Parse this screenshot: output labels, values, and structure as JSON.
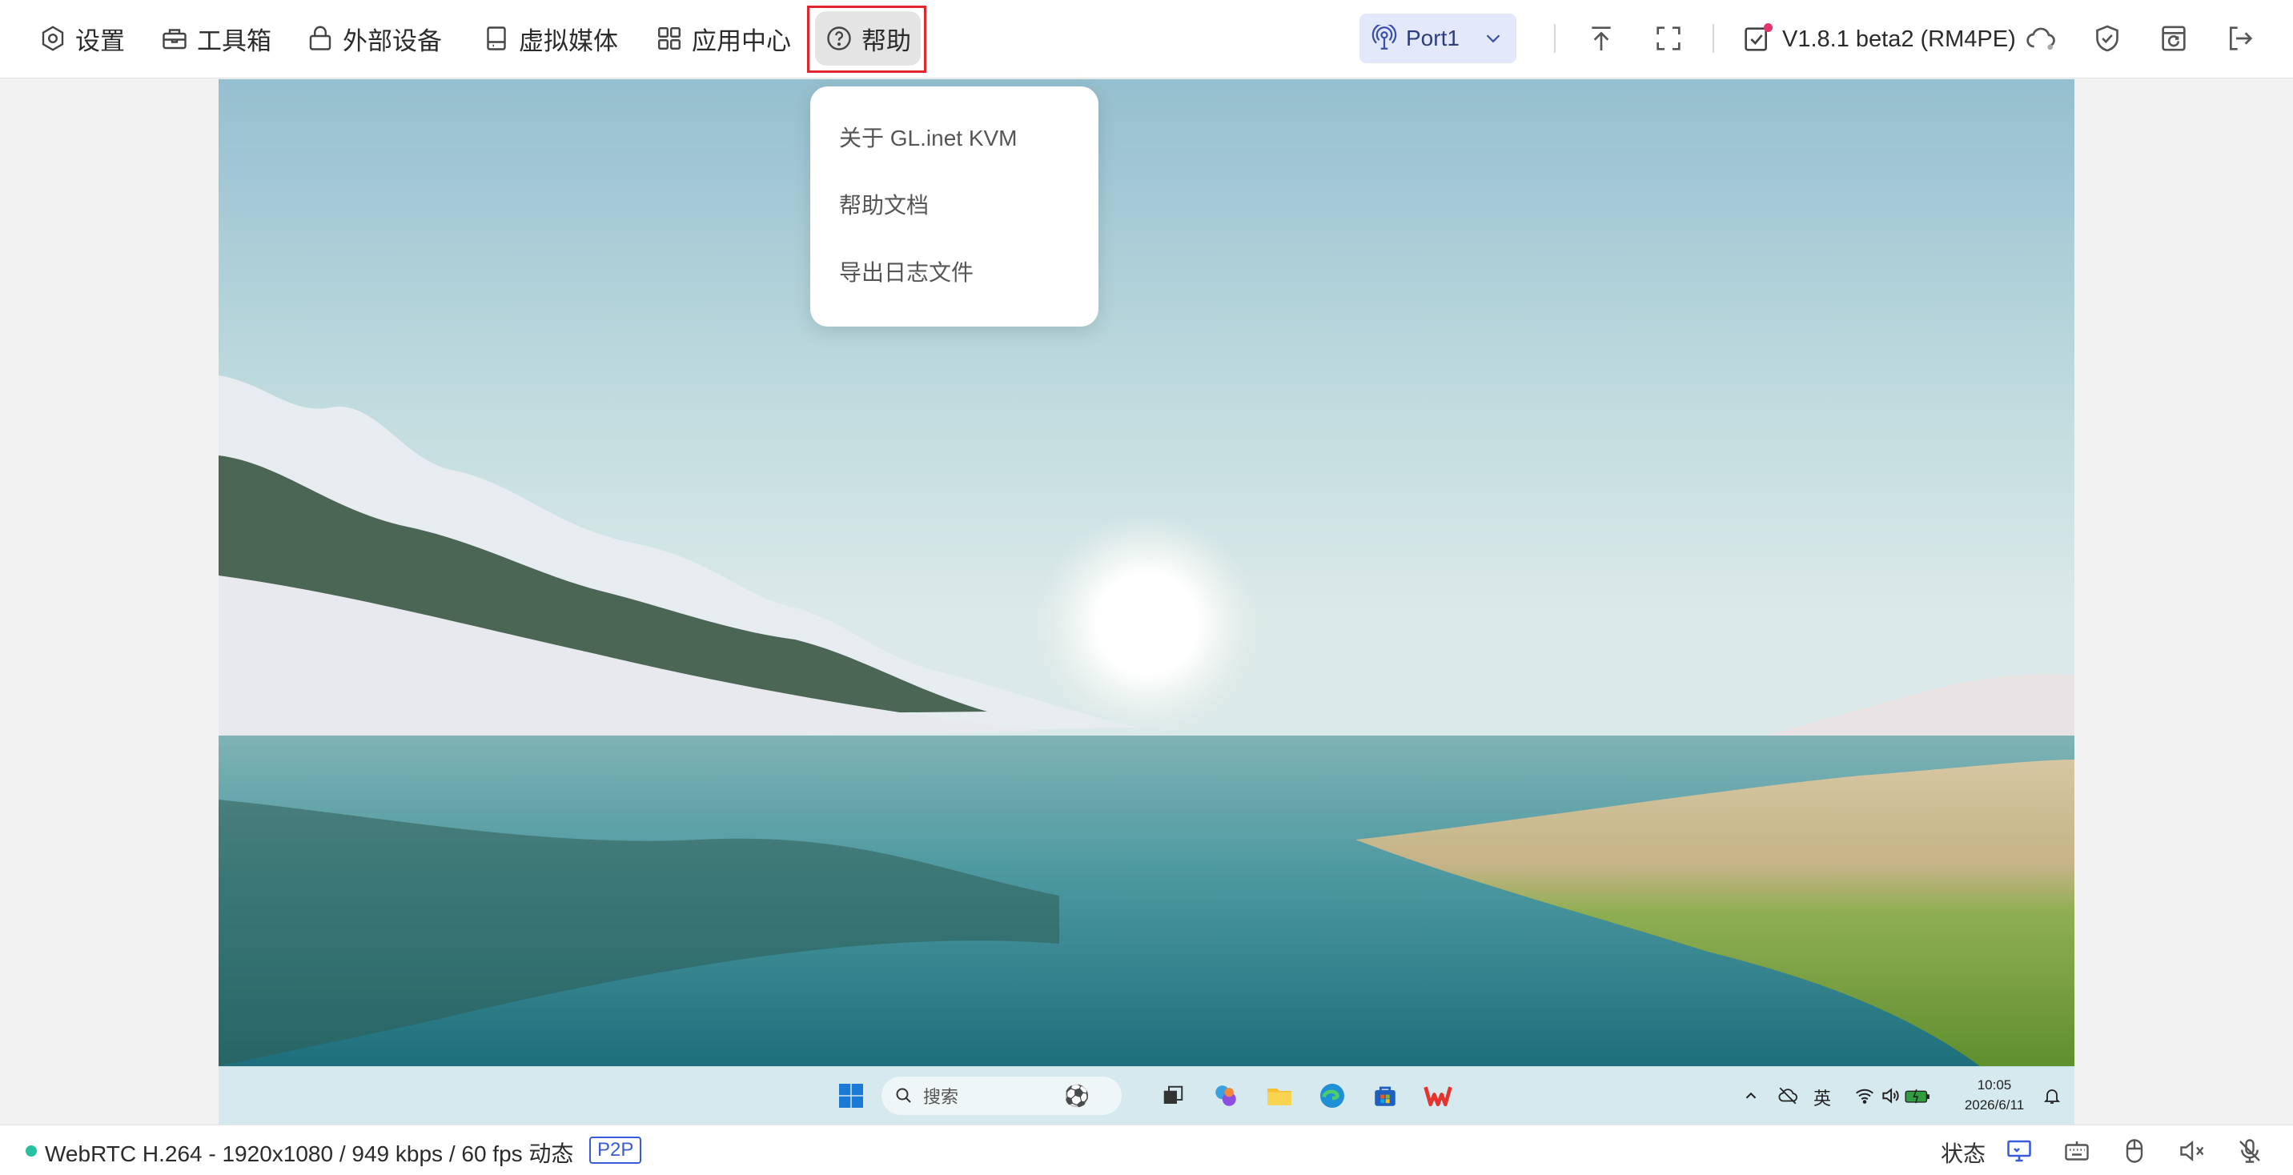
{
  "toolbar": {
    "menu": [
      {
        "label": "设置",
        "icon": "settings-icon"
      },
      {
        "label": "工具箱",
        "icon": "toolbox-icon"
      },
      {
        "label": "外部设备",
        "icon": "lock-device-icon"
      },
      {
        "label": "虚拟媒体",
        "icon": "drive-icon"
      },
      {
        "label": "应用中心",
        "icon": "app-grid-icon"
      },
      {
        "label": "帮助",
        "icon": "help-icon",
        "active": true
      }
    ],
    "port": {
      "label": "Port1"
    },
    "version": {
      "label": "V1.8.1 beta2 (RM4PE)"
    },
    "right_icons": [
      "upload-icon",
      "fullscreen-icon",
      "cloud-icon",
      "shield-check-icon",
      "refresh-doc-icon",
      "logout-icon"
    ]
  },
  "help_dropdown": {
    "items": [
      {
        "label": "关于 GL.inet KVM"
      },
      {
        "label": "帮助文档"
      },
      {
        "label": "导出日志文件"
      }
    ]
  },
  "remote_desktop": {
    "taskbar": {
      "search_placeholder": "搜索",
      "ime_label": "英",
      "clock_time": "10:05",
      "clock_date": "2026/6/11"
    }
  },
  "statusbar": {
    "stream_info": "WebRTC H.264 - 1920x1080 / 949 kbps / 60 fps 动态",
    "badge": "P2P",
    "status_label": "状态"
  },
  "colors": {
    "accent": "#3a5bd9",
    "port_bg": "#e3e9fb",
    "active_outline": "#e0262e",
    "status_dot": "#27c0a0"
  }
}
